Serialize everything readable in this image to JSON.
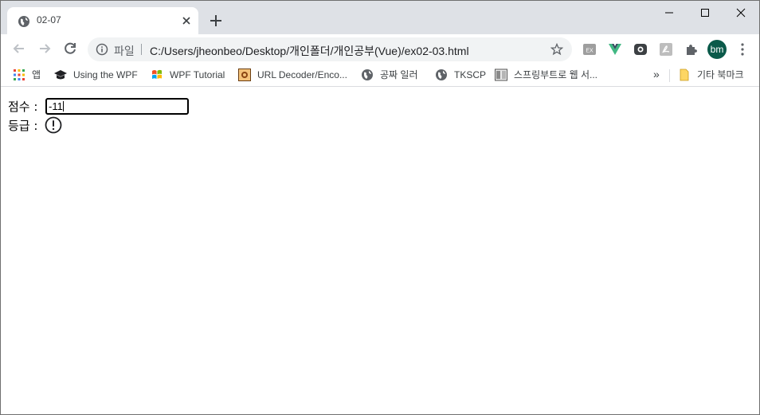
{
  "tab": {
    "title": "02-07",
    "favicon": "globe-icon",
    "close": "close-icon"
  },
  "window_controls": [
    "minimize-icon",
    "maximize-icon",
    "close-icon"
  ],
  "toolbar": {
    "scheme_label": "파일",
    "url": "C:/Users/jheonbeo/Desktop/개인폴더/개인공부(Vue)/ex02-03.html",
    "profile_initials": "bm",
    "extensions": [
      "ex-extension-icon",
      "vue-devtools-icon",
      "record-icon",
      "pdf-icon",
      "puzzle-icon"
    ]
  },
  "bookmarks": [
    {
      "label": "앱",
      "icon": "apps-grid-icon"
    },
    {
      "label": "Using the WPF",
      "icon": "graduation-cap-icon"
    },
    {
      "label": "WPF Tutorial",
      "icon": "windows-logo-icon"
    },
    {
      "label": "URL Decoder/Enco...",
      "icon": "site-favicon-icon"
    },
    {
      "label": "공짜 일러",
      "icon": "globe-icon"
    },
    {
      "label": "TKSCP",
      "icon": "globe-icon"
    },
    {
      "label": "스프링부트로 웹 서...",
      "icon": "book-favicon-icon"
    }
  ],
  "bookmarks_other": {
    "label": "기타 북마크",
    "icon": "folder-icon",
    "overflow": "»"
  },
  "page": {
    "score_label": "점수 :",
    "score_value": "-11",
    "grade_label": "등급 :",
    "grade_icon": "exclamation-circle-icon"
  }
}
